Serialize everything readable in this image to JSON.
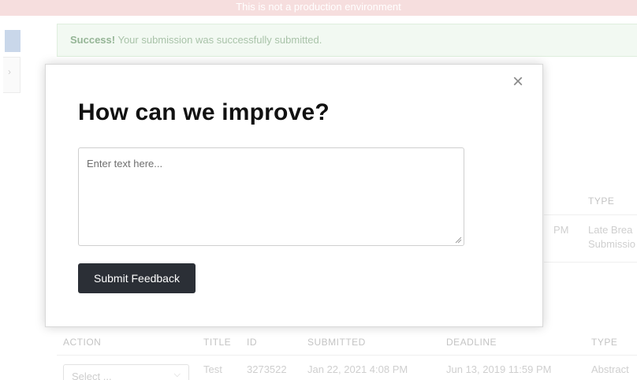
{
  "banner": {
    "text": "This is not a production environment"
  },
  "alert": {
    "strong": "Success!",
    "message": " Your submission was successfully submitted."
  },
  "table_top": {
    "type_header": "TYPE",
    "row1": {
      "time_tail": "PM",
      "type_line1": "Late Brea",
      "type_line2": "Submissio"
    }
  },
  "table_bottom": {
    "headers": {
      "action": "ACTION",
      "title": "TITLE",
      "id": "ID",
      "submitted": "SUBMITTED",
      "deadline": "DEADLINE",
      "type": "TYPE"
    },
    "row": {
      "select_value": "Select ...",
      "title": "Test",
      "id": "3273522",
      "submitted": "Jan 22, 2021 4:08 PM",
      "deadline": "Jun 13, 2019 11:59 PM",
      "type": "Abstract"
    }
  },
  "modal": {
    "title": "How can we improve?",
    "close_symbol": "×",
    "textarea_placeholder": "Enter text here...",
    "textarea_value": "",
    "submit_label": "Submit Feedback"
  },
  "icons": {
    "close": "close-icon",
    "resize": "resize-handle-icon",
    "chevron_right": "chevron-right-icon",
    "chevron_down": "chevron-down-icon"
  },
  "colors": {
    "button_bg": "#2b2f36",
    "banner_bg": "#f6dede",
    "alert_bg": "#f2f9f2"
  }
}
